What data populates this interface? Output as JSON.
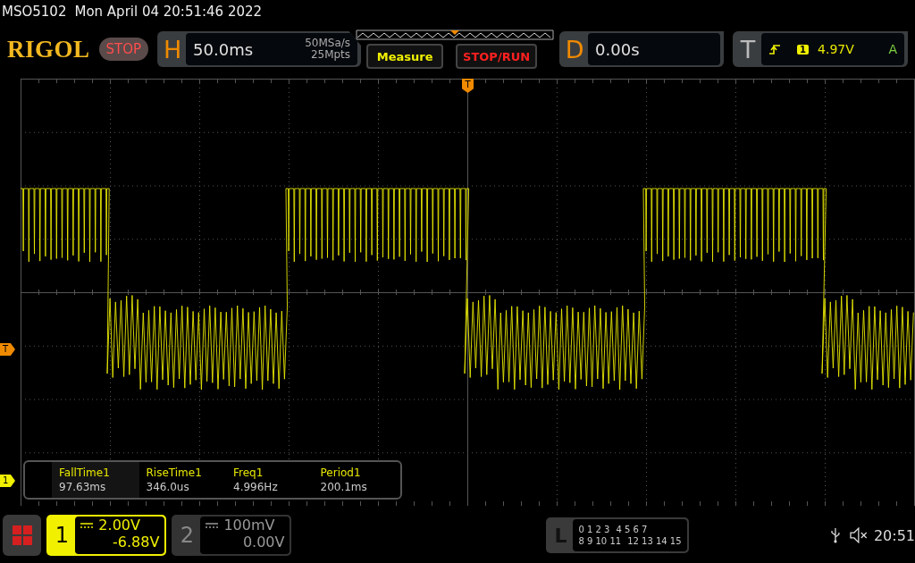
{
  "status_line": {
    "model": "MSO5102",
    "datetime": "Mon April 04 20:51:46 2022"
  },
  "logo": "RIGOL",
  "run_state": {
    "label": "STOP",
    "running": false
  },
  "horizontal": {
    "label": "H",
    "timebase": "50.0ms",
    "sample_rate": "50MSa/s",
    "memory_depth": "25Mpts"
  },
  "menu_buttons": [
    {
      "label": "Measure",
      "kind": "measure"
    },
    {
      "label": "STOP/RUN",
      "kind": "stoprun"
    }
  ],
  "delay": {
    "label": "D",
    "value": "0.00s"
  },
  "trigger": {
    "label": "T",
    "source": "1",
    "level": "4.97V",
    "mode": "A"
  },
  "display_markers": {
    "trigger_position": "T",
    "trigger_level": "T",
    "channel": "1"
  },
  "measurements": [
    {
      "name": "FallTime1",
      "value": "97.63ms",
      "selected": true
    },
    {
      "name": "RiseTime1",
      "value": "346.0us",
      "selected": false
    },
    {
      "name": "Freq1",
      "value": "4.996Hz",
      "selected": false
    },
    {
      "name": "Period1",
      "value": "200.1ms",
      "selected": false
    }
  ],
  "channels": [
    {
      "number": "1",
      "scale": "2.00V",
      "offset": "-6.88V",
      "active": true
    },
    {
      "number": "2",
      "scale": "100mV",
      "offset": "0.00V",
      "active": false
    }
  ],
  "logic": {
    "label": "L",
    "rows": [
      [
        "0 1 2 3",
        "4 5 6 7"
      ],
      [
        "8 9 10 11",
        "12 13 14 15"
      ]
    ]
  },
  "clock": "20:51"
}
